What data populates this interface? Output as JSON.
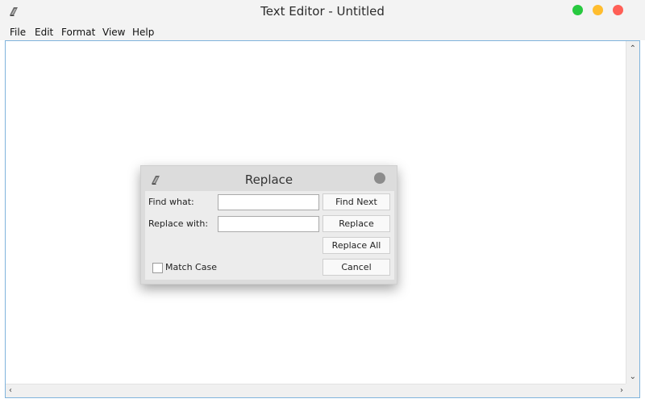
{
  "window": {
    "title": "Text Editor - Untitled",
    "icon": "book-icon",
    "controls": {
      "green": "#27c93f",
      "yellow": "#ffbd2e",
      "red": "#ff5f56"
    }
  },
  "menubar": {
    "items": [
      "File",
      "Edit",
      "Format",
      "View",
      "Help"
    ]
  },
  "editor": {
    "content": ""
  },
  "dialog": {
    "title": "Replace",
    "find_label": "Find what:",
    "find_value": "",
    "replace_label": "Replace with:",
    "replace_value": "",
    "buttons": {
      "find_next": "Find Next",
      "replace": "Replace",
      "replace_all": "Replace All",
      "cancel": "Cancel"
    },
    "match_case_label": "Match Case",
    "match_case_checked": false
  }
}
